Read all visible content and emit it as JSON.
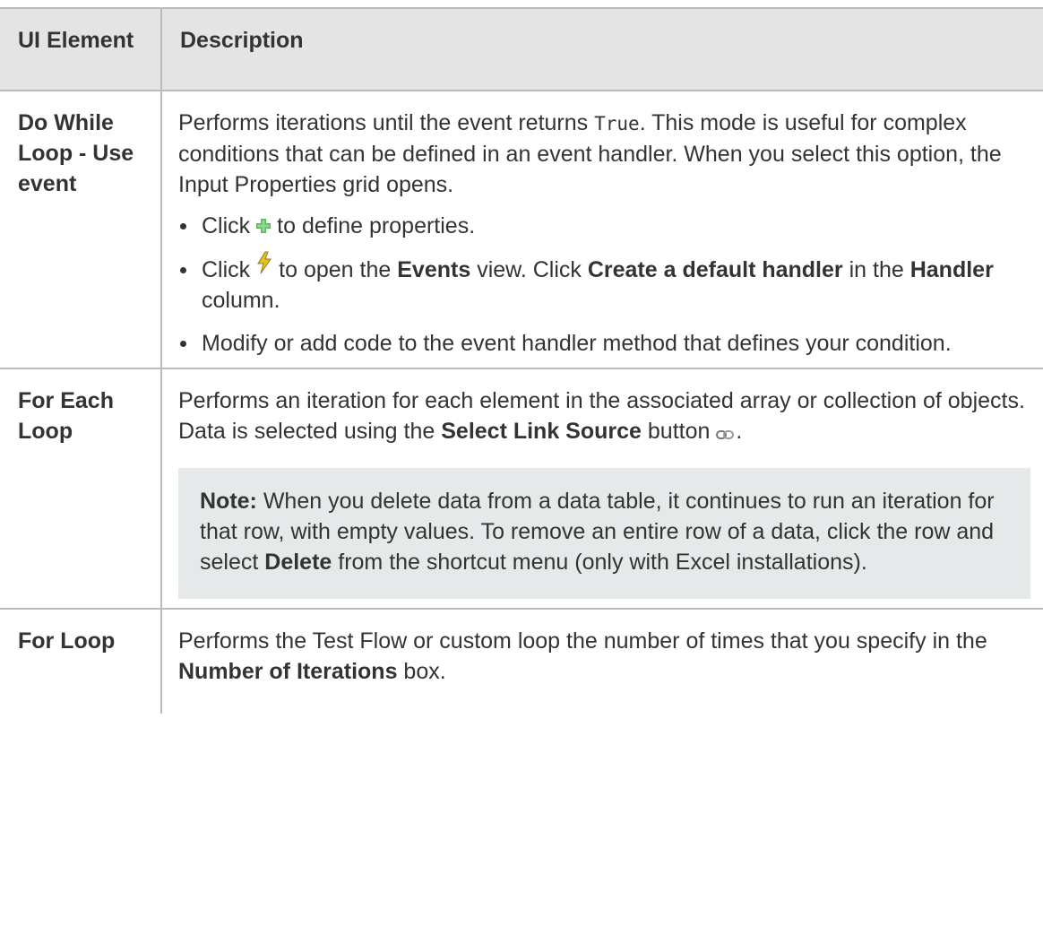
{
  "table": {
    "headers": {
      "col1": "UI Element",
      "col2": "Description"
    },
    "rows": [
      {
        "element": "Do While Loop - Use event",
        "desc_prefix": "Performs iterations until the event returns ",
        "desc_code": "True",
        "desc_suffix": ". This mode is useful for complex conditions that can be defined in an event handler. When you select this option, the Input Properties grid opens.",
        "bullets": [
          {
            "before": "Click",
            "icon": "green-plus-icon",
            "after": "to define properties."
          },
          {
            "before": "Click",
            "icon": "lightning-bolt-icon",
            "after": "to open the",
            "b1": "Events",
            "mid1": "view. Click",
            "b2": "Create a default handler",
            "mid2": "in the",
            "b3": "Handler",
            "end": "column."
          },
          {
            "text": "Modify or add code to the event handler method that defines your condition."
          }
        ]
      },
      {
        "element": "For Each Loop",
        "desc_prefix": "Performs an iteration for each element in the associated array or collection of objects. Data is selected using the ",
        "desc_bold": "Select Link Source",
        "desc_mid": " button ",
        "desc_icon": "link-chain-icon",
        "desc_end": ".",
        "note": {
          "label": "Note:",
          "text1": " When you delete data from a data table, it continues to run an iteration for that row, with empty values. To remove an entire row of a data, click the row and select ",
          "bold": "Delete",
          "text2": " from the shortcut menu (only with Excel installations)."
        }
      },
      {
        "element": "For Loop",
        "desc_prefix": "Performs the Test Flow or custom loop the number of times that you specify in the ",
        "desc_bold": "Number of Iterations",
        "desc_end": " box."
      }
    ]
  },
  "colors": {
    "header_bg": "#e4e4e4",
    "note_bg": "#e6e9e9",
    "border": "#bbbbbb",
    "text": "#333333",
    "plus_green": "#5cb85c",
    "bolt_yellow": "#e8c21a"
  }
}
